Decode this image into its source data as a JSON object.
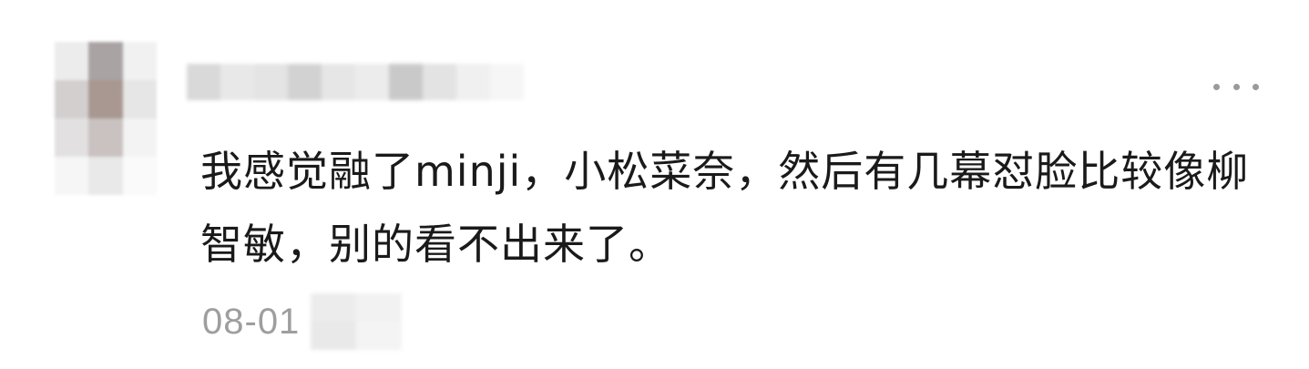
{
  "comment": {
    "text": "我感觉融了minji，小松菜奈，然后有几幕怼脸比较像柳智敏，别的看不出来了。",
    "date": "08-01",
    "more_icon": "more-horizontal-icon"
  },
  "colors": {
    "text": "#1a1a1a",
    "date": "#9e9e9e",
    "more_dots": "#9a9a9a",
    "avatar_mosaic": [
      "#ececec",
      "#a9a3a3",
      "#f1f1f1",
      "#d3cfcf",
      "#a99891",
      "#e6e6e6",
      "#e2e0e0",
      "#c9c2c0",
      "#f3f3f3",
      "#f6f6f6",
      "#e9e9e9",
      "#fafafa"
    ],
    "username_mosaic": [
      "#d9d9d9",
      "#e8e8e8",
      "#e4e4e4",
      "#d2d2d2",
      "#e6e6e6",
      "#ececec",
      "#c9c9c9",
      "#e3e3e3",
      "#f0f0f0",
      "#f6f6f6"
    ],
    "location_mosaic": [
      "#ececec",
      "#f2f2f2",
      "#e9e9e9",
      "#f4f4f4"
    ]
  }
}
